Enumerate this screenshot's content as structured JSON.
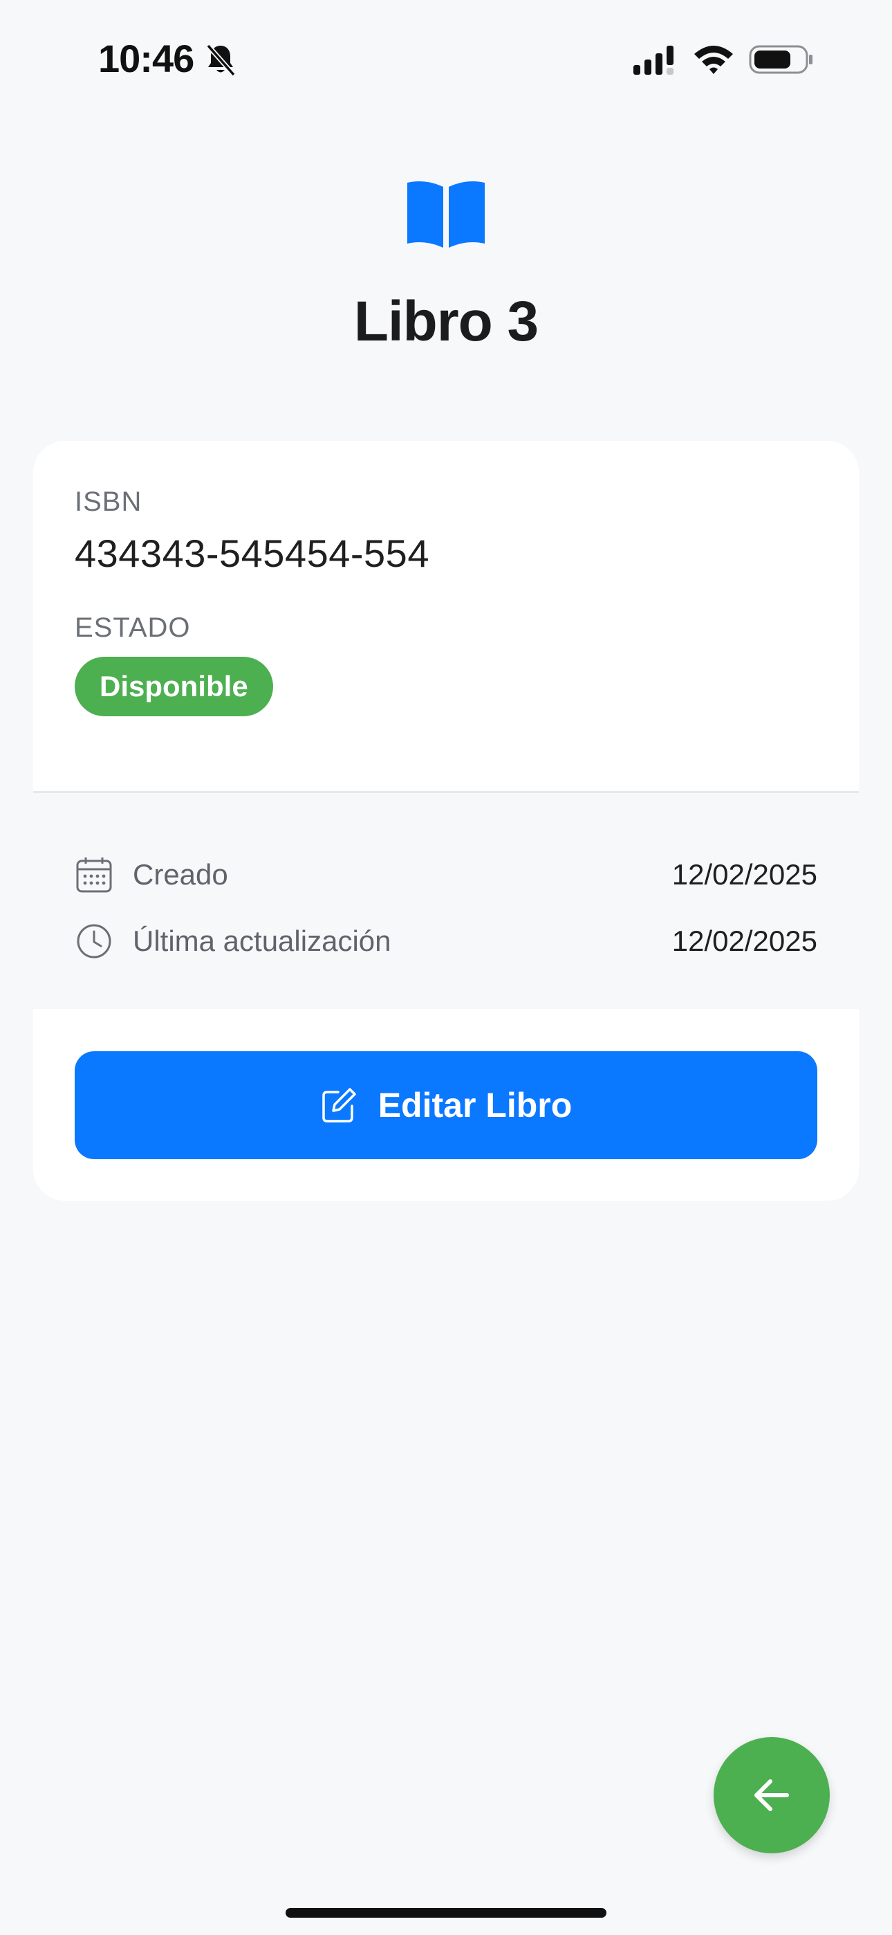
{
  "status_bar": {
    "time": "10:46"
  },
  "header": {
    "title": "Libro 3",
    "icon": "book-open-icon"
  },
  "details": {
    "isbn_label": "ISBN",
    "isbn_value": "434343-545454-554",
    "estado_label": "ESTADO",
    "estado_value": "Disponible"
  },
  "meta": {
    "created_label": "Creado",
    "created_value": "12/02/2025",
    "updated_label": "Última actualización",
    "updated_value": "12/02/2025"
  },
  "actions": {
    "edit_label": "Editar Libro"
  },
  "colors": {
    "accent": "#0a78ff",
    "success": "#4caf50",
    "background": "#f7f8fa"
  }
}
